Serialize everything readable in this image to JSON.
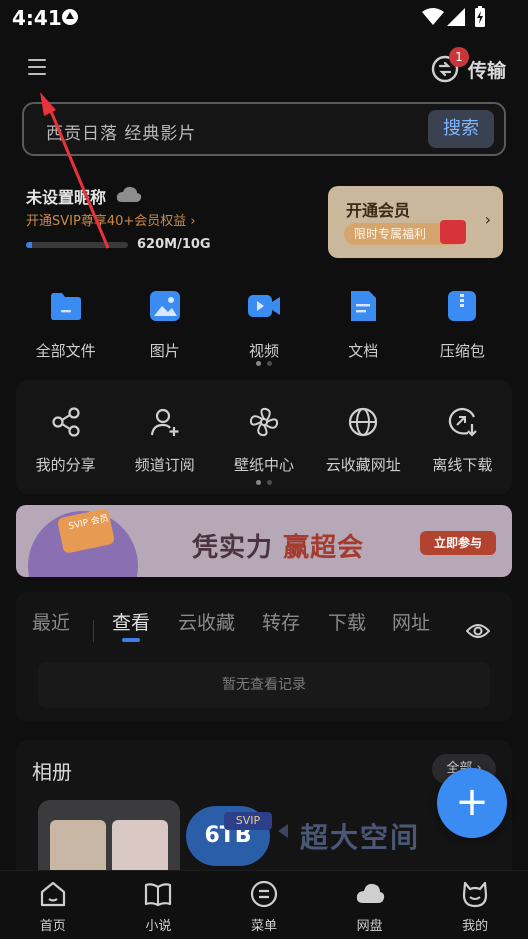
{
  "status_bar": {
    "time": "4:41"
  },
  "header": {
    "transfer_label": "传输",
    "transfer_badge": "1"
  },
  "search": {
    "placeholder": "西贡日落 经典影片",
    "button_label": "搜索"
  },
  "user": {
    "nickname": "未设置昵称",
    "promo": "开通SVIP尊享40+会员权益 ›",
    "storage_text": "620M/10G",
    "storage_used_fraction": 0.06
  },
  "vip_card": {
    "title": "开通会员",
    "subtitle": "限时专属福利",
    "chevron": "›"
  },
  "quick_grid": [
    {
      "label": "全部文件",
      "icon": "folder-icon"
    },
    {
      "label": "图片",
      "icon": "image-icon"
    },
    {
      "label": "视频",
      "icon": "video-icon"
    },
    {
      "label": "文档",
      "icon": "document-icon"
    },
    {
      "label": "压缩包",
      "icon": "zip-icon"
    }
  ],
  "tool_grid": [
    {
      "label": "我的分享",
      "icon": "share-icon"
    },
    {
      "label": "频道订阅",
      "icon": "user-plus-icon"
    },
    {
      "label": "壁纸中心",
      "icon": "pinwheel-icon"
    },
    {
      "label": "云收藏网址",
      "icon": "globe-icon"
    },
    {
      "label": "离线下载",
      "icon": "offline-download-icon"
    }
  ],
  "banner": {
    "main_prefix": "凭实力 ",
    "main_highlight": "赢超会",
    "cta": "立即参与",
    "card_tag": "SVIP 会员"
  },
  "recent": {
    "tabs": [
      "最近",
      "查看",
      "云收藏",
      "转存",
      "下载",
      "网址"
    ],
    "active_tab": "查看",
    "empty_text": "暂无查看记录"
  },
  "album": {
    "title": "相册",
    "all_label": "全部 ›",
    "promo_capacity": "6TB",
    "promo_chip": "SVIP",
    "promo_slogan": "超大空间"
  },
  "fab_label": "+",
  "bottom_nav": [
    {
      "label": "首页",
      "icon": "home-icon"
    },
    {
      "label": "小说",
      "icon": "book-icon"
    },
    {
      "label": "菜单",
      "icon": "menu-circle-icon"
    },
    {
      "label": "网盘",
      "icon": "cloud-drive-icon"
    },
    {
      "label": "我的",
      "icon": "profile-cat-icon"
    }
  ],
  "colors": {
    "accent_blue": "#3a8cf2",
    "vip_gold": "#cbb79b",
    "badge_red": "#c7373a",
    "annotation_arrow": "#e8333a"
  }
}
